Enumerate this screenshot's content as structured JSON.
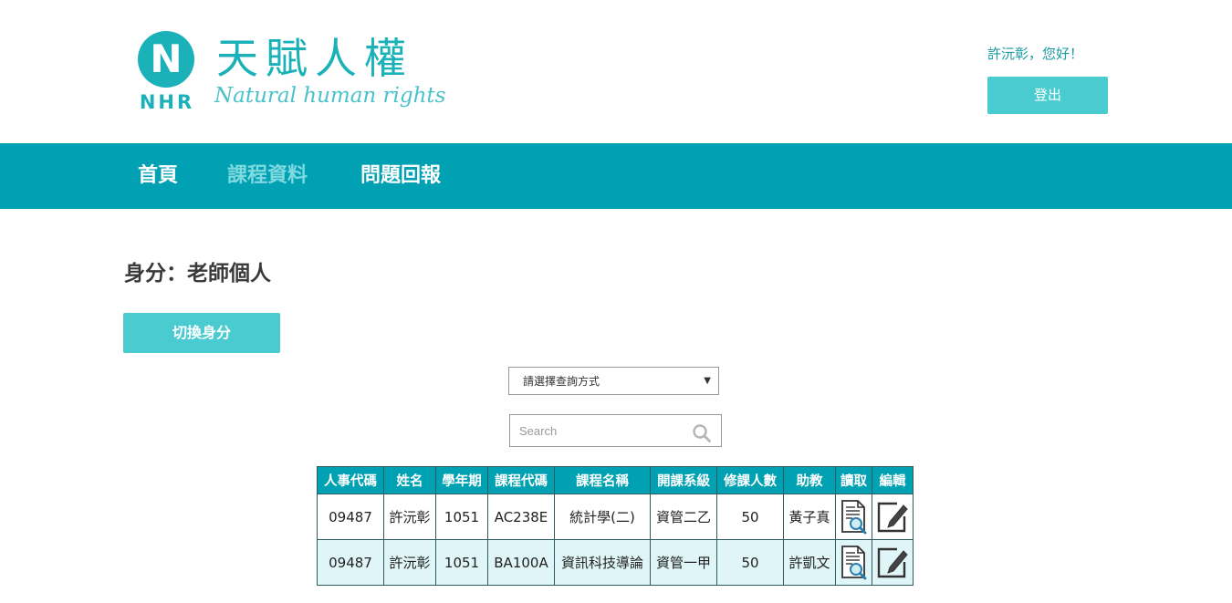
{
  "brand": {
    "logo_letter": "N",
    "logo_abbr": "NHR",
    "title_cn": "天賦人權",
    "title_en": "Natural human rights",
    "color": "#1ab2b8"
  },
  "user": {
    "greeting": "許沅彰，您好！",
    "logout_label": "登出"
  },
  "nav": {
    "items": [
      {
        "label": "首頁",
        "active": false
      },
      {
        "label": "課程資料",
        "active": true
      },
      {
        "label": "問題回報",
        "active": false
      }
    ],
    "background": "#00a1b2"
  },
  "identity": {
    "label": "身分：老師個人",
    "switch_label": "切換身分"
  },
  "query": {
    "select_value": "請選擇查詢方式",
    "search_placeholder": "Search"
  },
  "table": {
    "headers": [
      "人事代碼",
      "姓名",
      "學年期",
      "課程代碼",
      "課程名稱",
      "開課系級",
      "修課人數",
      "助教",
      "讀取",
      "編輯"
    ],
    "rows": [
      [
        "09487",
        "許沅彰",
        "1051",
        "AC238E",
        "統計學(二)",
        "資管二乙",
        "50",
        "黃子真"
      ],
      [
        "09487",
        "許沅彰",
        "1051",
        "BA100A",
        "資訊科技導論",
        "資管一甲",
        "50",
        "許凱文"
      ]
    ],
    "read_icon": "document-search-icon",
    "edit_icon": "edit-pencil-icon"
  },
  "colors": {
    "accent": "#49cbd0",
    "header_text": "#1a9aa2",
    "row_alt": "#dff5f7"
  }
}
